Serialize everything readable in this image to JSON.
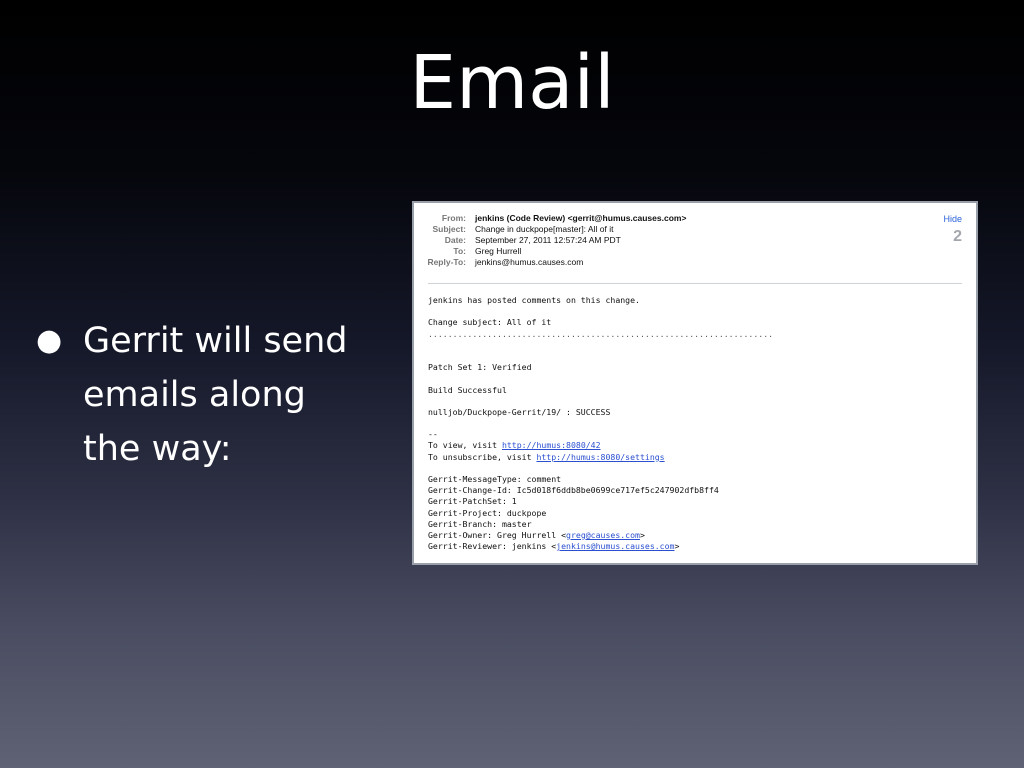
{
  "slide": {
    "title": "Email",
    "bullet": "Gerrit will send emails along the way:"
  },
  "email": {
    "headers": [
      {
        "label": "From:",
        "value": "jenkins (Code Review) <gerrit@humus.causes.com>",
        "bold": true
      },
      {
        "label": "Subject:",
        "value": "Change in duckpope[master]: All of it",
        "bold": false
      },
      {
        "label": "Date:",
        "value": "September 27, 2011 12:57:24 AM PDT",
        "bold": false
      },
      {
        "label": "To:",
        "value": "Greg Hurrell",
        "bold": false
      },
      {
        "label": "Reply-To:",
        "value": "jenkins@humus.causes.com",
        "bold": false
      }
    ],
    "hide_label": "Hide",
    "message_count": "2",
    "body": {
      "line1": "jenkins has posted comments on this change.",
      "change_subject": "Change subject: All of it",
      "dotted_rule": "......................................................................",
      "patch_set": "Patch Set 1: Verified",
      "build": "Build Successful",
      "job": "nulljob/Duckpope-Gerrit/19/ : SUCCESS",
      "sig": "--",
      "view_prefix": "To view, visit ",
      "view_link": "http://humus:8080/42",
      "unsub_prefix": "To unsubscribe, visit ",
      "unsub_link": "http://humus:8080/settings",
      "message_type": "Gerrit-MessageType: comment",
      "change_id": "Gerrit-Change-Id: Ic5d018f6ddb8be0699ce717ef5c247902dfb8ff4",
      "patchset": "Gerrit-PatchSet: 1",
      "project": "Gerrit-Project: duckpope",
      "branch": "Gerrit-Branch: master",
      "owner_prefix": "Gerrit-Owner: Greg Hurrell <",
      "owner_link": "greg@causes.com",
      "owner_suffix": ">",
      "reviewer_prefix": "Gerrit-Reviewer: jenkins <",
      "reviewer_link": "jenkins@humus.causes.com",
      "reviewer_suffix": ">"
    }
  }
}
